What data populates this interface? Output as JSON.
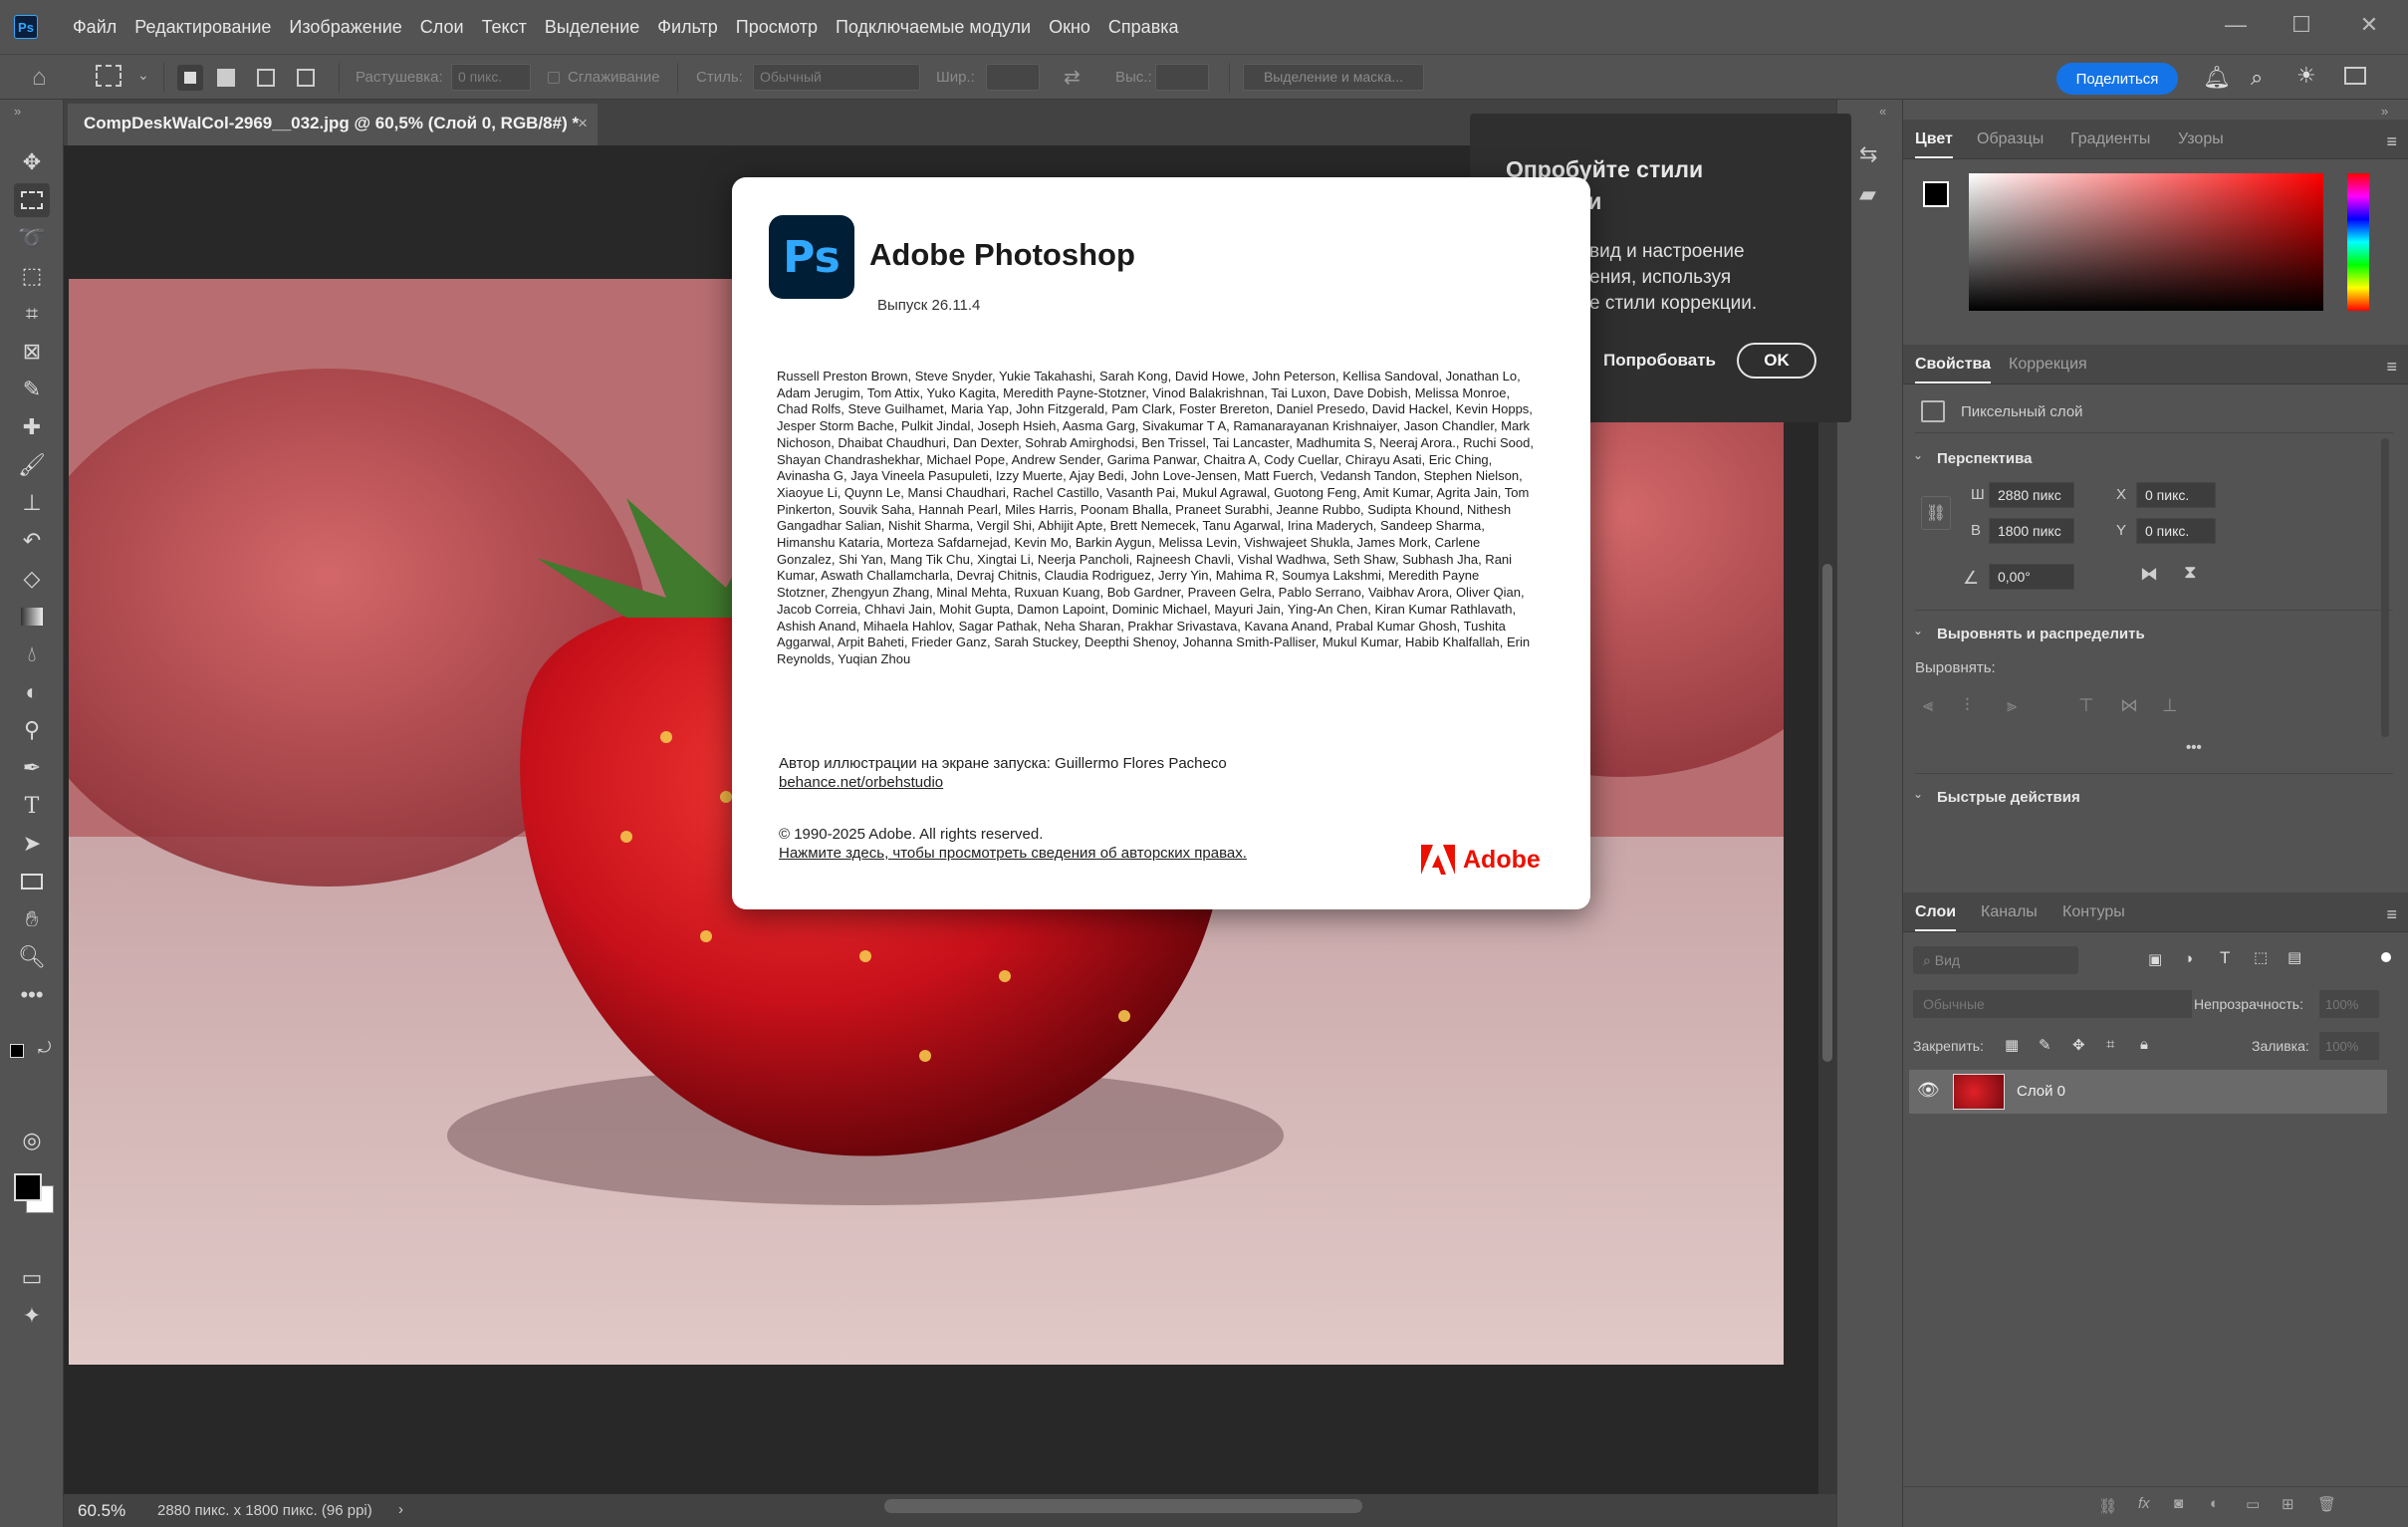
{
  "app": {
    "logo": "Ps"
  },
  "menu": [
    "Файл",
    "Редактирование",
    "Изображение",
    "Слои",
    "Текст",
    "Выделение",
    "Фильтр",
    "Просмотр",
    "Подключаемые модули",
    "Окно",
    "Справка"
  ],
  "window_controls": {
    "minimize": "—",
    "maximize": "☐",
    "close": "✕"
  },
  "options": {
    "feather_label": "Растушевка:",
    "feather_value": "0 пикс.",
    "antialias_label": "Сглаживание",
    "style_label": "Стиль:",
    "style_value": "Обычный",
    "width_label": "Шир.:",
    "height_label": "Выс.:",
    "mask_button": "Выделение и маска...",
    "share": "Поделиться"
  },
  "document": {
    "tab_title": "CompDeskWalCol-2969__032.jpg @ 60,5% (Слой 0, RGB/8#) *",
    "close": "×",
    "zoom": "60.5%",
    "info": "2880 пикс. x 1800 пикс. (96 ppi)",
    "info_arrow": "›"
  },
  "tip": {
    "title_line1": "Опробуйте стили",
    "title_line2": "ции",
    "body_line1": "вид и настроение",
    "body_line2": "ения, используя",
    "body_line3": "е стили коррекции.",
    "try": "Попробовать",
    "ok": "OK"
  },
  "about": {
    "logo": "Ps",
    "title": "Adobe Photoshop",
    "version": "Выпуск 26.11.4",
    "credits": "Russell Preston Brown, Steve Snyder, Yukie Takahashi, Sarah Kong, David Howe, John Peterson, Kellisa Sandoval, Jonathan Lo, Adam Jerugim, Tom Attix, Yuko Kagita, Meredith Payne-Stotzner, Vinod Balakrishnan, Tai Luxon, Dave Dobish, Melissa Monroe, Chad Rolfs, Steve Guilhamet, Maria Yap, John Fitzgerald, Pam Clark, Foster Brereton, Daniel Presedo, David Hackel, Kevin Hopps, Jesper Storm Bache, Pulkit Jindal, Joseph Hsieh, Aasma Garg, Sivakumar T A, Ramanarayanan Krishnaiyer, Jason Chandler, Mark Nichoson, Dhaibat Chaudhuri, Dan Dexter, Sohrab Amirghodsi, Ben Trissel, Tai Lancaster, Madhumita S, Neeraj Arora., Ruchi Sood, Shayan Chandrashekhar, Michael Pope, Andrew Sender, Garima Panwar, Chaitra A, Cody Cuellar, Chirayu Asati, Eric Ching, Avinasha G, Jaya Vineela Pasupuleti, Izzy Muerte, Ajay Bedi, John Love-Jensen, Matt Fuerch, Vedansh Tandon, Stephen Nielson, Xiaoyue Li, Quynn Le, Mansi Chaudhari, Rachel Castillo, Vasanth Pai, Mukul Agrawal, Guotong Feng, Amit Kumar, Agrita Jain, Tom Pinkerton, Souvik Saha, Hannah Pearl, Miles Harris, Poonam Bhalla, Praneet Surabhi, Jeanne Rubbo, Sudipta Khound, Nithesh Gangadhar Salian, Nishit Sharma, Vergil Shi, Abhijit Apte, Brett Nemecek, Tanu Agarwal, Irina Maderych, Sandeep Sharma, Himanshu Kataria, Morteza Safdarnejad, Kevin Mo, Barkin Aygun, Melissa Levin, Vishwajeet Shukla, James Mork, Carlene Gonzalez, Shi Yan, Mang Tik Chu, Xingtai Li, Neerja Pancholi, Rajneesh Chavli, Vishal Wadhwa, Seth Shaw, Subhash Jha, Rani Kumar, Aswath Challamcharla, Devraj Chitnis, Claudia Rodriguez, Jerry Yin, Mahima R, Soumya Lakshmi, Meredith Payne Stotzner, Zhengyun Zhang, Minal Mehta, Ruxuan Kuang, Bob Gardner, Praveen Gelra, Pablo Serrano, Vaibhav Arora, Oliver Qian, Jacob Correia, Chhavi Jain, Mohit Gupta, Damon Lapoint, Dominic Michael, Mayuri Jain, Ying-An Chen, Kiran Kumar Rathlavath, Ashish Anand, Mihaela Hahlov, Sagar Pathak, Neha Sharan, Prakhar Srivastava, Kavana Anand, Prabal Kumar Ghosh, Tushita Aggarwal, Arpit Baheti, Frieder Ganz, Sarah Stuckey, Deepthi Shenoy, Johanna Smith-Palliser, Mukul Kumar, Habib Khalfallah, Erin Reynolds, Yuqian Zhou",
    "artist": "Автор иллюстрации на экране запуска: Guillermo Flores Pacheco",
    "artist_link": "behance.net/orbehstudio",
    "copyright": "© 1990-2025 Adobe. All rights reserved.",
    "copyright_link": "Нажмите здесь, чтобы просмотреть сведения об авторских правах.",
    "brand": "Adobe"
  },
  "color_panel": {
    "tabs": [
      "Цвет",
      "Образцы",
      "Градиенты",
      "Узоры"
    ]
  },
  "properties": {
    "tabs": [
      "Свойства",
      "Коррекция"
    ],
    "layer_type": "Пиксельный слой",
    "perspective": "Перспектива",
    "w_label": "Ш",
    "w_value": "2880 пикс",
    "h_label": "В",
    "h_value": "1800 пикс",
    "x_label": "X",
    "x_value": "0 пикс.",
    "y_label": "Y",
    "y_value": "0 пикс.",
    "angle_value": "0,00°",
    "align_title": "Выровнять и распределить",
    "align_label": "Выровнять:",
    "more": "•••",
    "quick_actions": "Быстрые действия"
  },
  "layers": {
    "tabs": [
      "Слои",
      "Каналы",
      "Контуры"
    ],
    "search_placeholder": "Вид",
    "blend_mode": "Обычные",
    "opacity_label": "Непрозрачность:",
    "opacity_value": "100%",
    "lock_label": "Закрепить:",
    "fill_label": "Заливка:",
    "fill_value": "100%",
    "layer_name": "Слой 0"
  },
  "colors": {
    "accent": "#1473e6",
    "ps_blue": "#31a8ff",
    "ps_dark": "#001e36",
    "adobe_red": "#eb1000"
  }
}
